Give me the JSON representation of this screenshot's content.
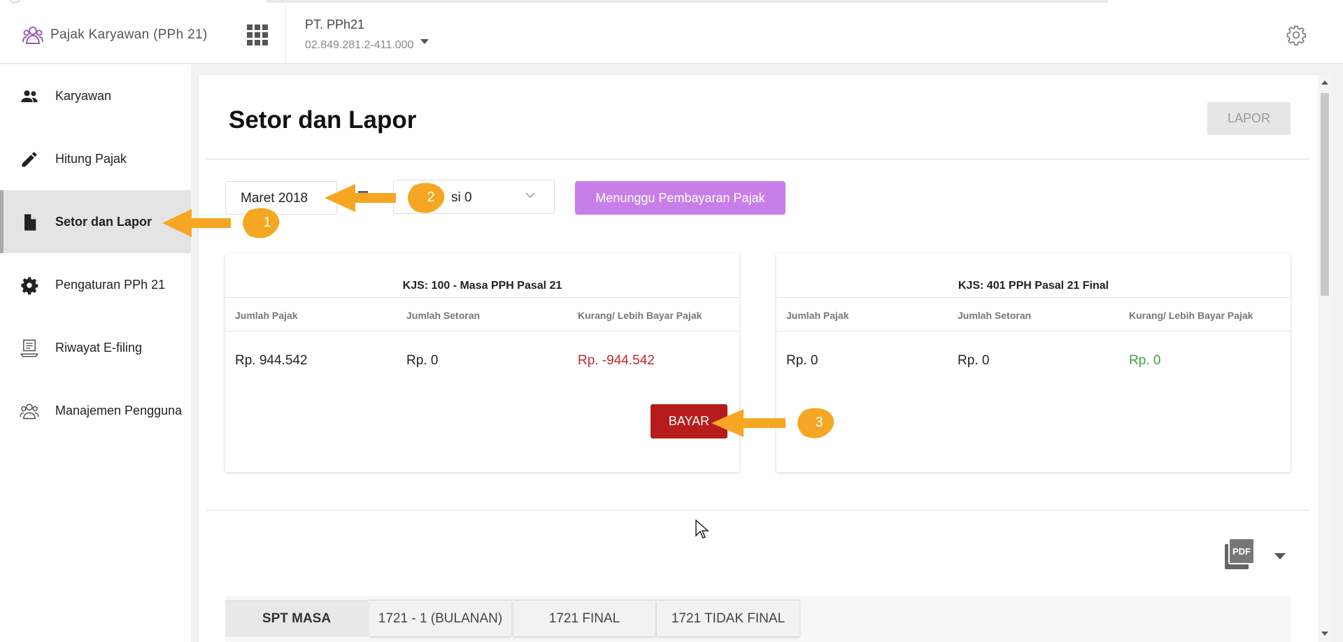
{
  "app": {
    "name": "Pajak Karyawan (PPh 21)",
    "company": "PT. PPh21",
    "npwp": "02.849.281.2-411.000"
  },
  "sidebar": {
    "items": [
      {
        "label": "Karyawan",
        "icon": "people-icon"
      },
      {
        "label": "Hitung Pajak",
        "icon": "pencil-icon"
      },
      {
        "label": "Setor dan Lapor",
        "icon": "document-icon",
        "active": true
      },
      {
        "label": "Pengaturan PPh 21",
        "icon": "gear-icon"
      },
      {
        "label": "Riwayat E-filing",
        "icon": "laptop-history-icon"
      },
      {
        "label": "Manajemen Pengguna",
        "icon": "users-manage-icon"
      }
    ]
  },
  "main": {
    "title": "Setor dan Lapor",
    "lapor_label": "LAPOR",
    "month": "Maret 2018",
    "pembetulan_visible": "si 0",
    "status_label": "Menunggu Pembayaran Pajak",
    "cards": [
      {
        "title": "KJS: 100 - Masa PPH Pasal 21",
        "headers": [
          "Jumlah Pajak",
          "Jumlah Setoran",
          "Kurang/ Lebih Bayar Pajak"
        ],
        "values": [
          "Rp. 944.542",
          "Rp. 0",
          "Rp. -944.542"
        ],
        "bayar_label": "BAYAR"
      },
      {
        "title": "KJS: 401 PPH Pasal 21 Final",
        "headers": [
          "Jumlah Pajak",
          "Jumlah Setoran",
          "Kurang/ Lebih Bayar Pajak"
        ],
        "values": [
          "Rp. 0",
          "Rp. 0",
          "Rp. 0"
        ]
      }
    ],
    "tabs": [
      "SPT MASA",
      "1721 - 1 (BULANAN)",
      "1721 FINAL",
      "1721 TIDAK FINAL"
    ]
  },
  "annotations": [
    "1",
    "2",
    "3"
  ],
  "colors": {
    "accent_purple": "#c87ee8",
    "bayar_red": "#b71c1c",
    "negative_red": "#c62828",
    "positive_green": "#43a047",
    "annotation_orange": "#f5a623"
  }
}
